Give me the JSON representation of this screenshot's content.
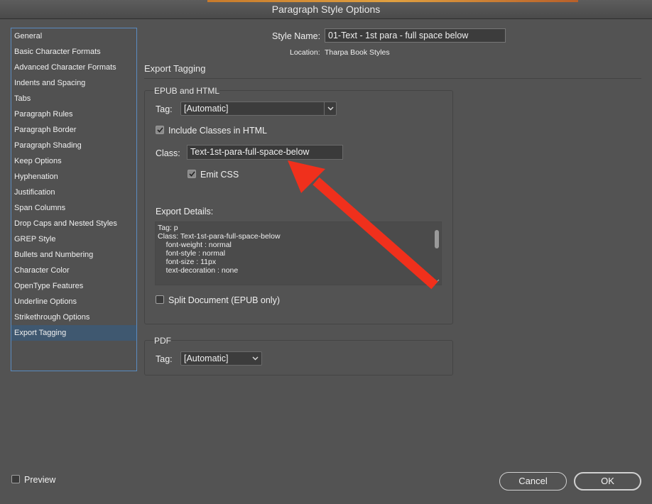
{
  "window": {
    "title": "Paragraph Style Options"
  },
  "sidebar": {
    "items": [
      {
        "label": "General"
      },
      {
        "label": "Basic Character Formats"
      },
      {
        "label": "Advanced Character Formats"
      },
      {
        "label": "Indents and Spacing"
      },
      {
        "label": "Tabs"
      },
      {
        "label": "Paragraph Rules"
      },
      {
        "label": "Paragraph Border"
      },
      {
        "label": "Paragraph Shading"
      },
      {
        "label": "Keep Options"
      },
      {
        "label": "Hyphenation"
      },
      {
        "label": "Justification"
      },
      {
        "label": "Span Columns"
      },
      {
        "label": "Drop Caps and Nested Styles"
      },
      {
        "label": "GREP Style"
      },
      {
        "label": "Bullets and Numbering"
      },
      {
        "label": "Character Color"
      },
      {
        "label": "OpenType Features"
      },
      {
        "label": "Underline Options"
      },
      {
        "label": "Strikethrough Options"
      },
      {
        "label": "Export Tagging"
      }
    ],
    "selected_index": 19
  },
  "header": {
    "style_name_label": "Style Name:",
    "style_name_value": "01-Text - 1st para - full space below",
    "location_label": "Location:",
    "location_value": "Tharpa Book Styles"
  },
  "section": {
    "title": "Export Tagging"
  },
  "epub": {
    "group_title": "EPUB and HTML",
    "tag_label": "Tag:",
    "tag_value": "[Automatic]",
    "include_classes_label": "Include Classes in HTML",
    "include_classes_checked": true,
    "class_label": "Class:",
    "class_value": "Text-1st-para-full-space-below",
    "emit_css_label": "Emit CSS",
    "emit_css_checked": true,
    "export_details_label": "Export Details:",
    "export_details_lines": [
      "Tag: p",
      "Class: Text-1st-para-full-space-below",
      "    font-weight : normal",
      "    font-style : normal",
      "    font-size : 11px",
      "    text-decoration : none"
    ],
    "split_document_label": "Split Document (EPUB only)",
    "split_document_checked": false
  },
  "pdf": {
    "group_title": "PDF",
    "tag_label": "Tag:",
    "tag_value": "[Automatic]"
  },
  "footer": {
    "preview_label": "Preview",
    "preview_checked": false,
    "cancel_label": "Cancel",
    "ok_label": "OK"
  },
  "annotation": {
    "arrow_color": "#f0301c"
  }
}
